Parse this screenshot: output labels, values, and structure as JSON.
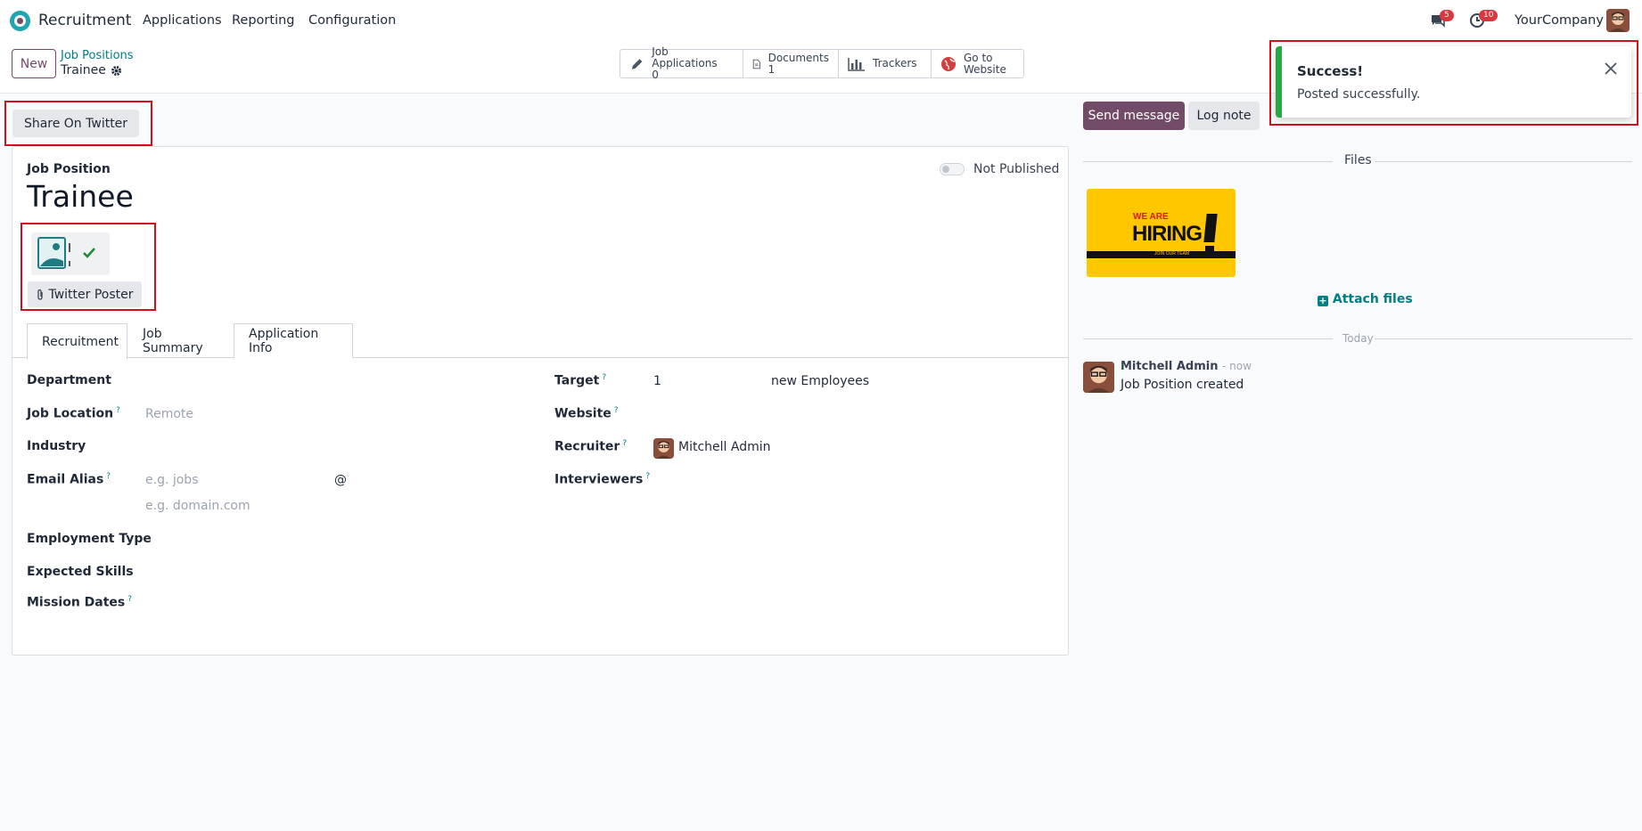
{
  "nav": {
    "app_name": "Recruitment",
    "menu": [
      "Applications",
      "Reporting",
      "Configuration"
    ],
    "messages_badge": "5",
    "activities_badge": "10",
    "company": "YourCompany"
  },
  "control": {
    "new_label": "New",
    "breadcrumb_parent": "Job Positions",
    "breadcrumb_current": "Trainee",
    "smart_buttons": [
      {
        "label": "Job Applications",
        "value": "0",
        "icon": "pencil-icon"
      },
      {
        "label": "Documents",
        "value": "1",
        "icon": "document-icon"
      },
      {
        "label": "Trackers",
        "value": "",
        "icon": "bar-chart-icon"
      },
      {
        "label": "Go to",
        "value": "Website",
        "icon": "globe-icon"
      }
    ]
  },
  "form": {
    "share_label": "Share On Twitter",
    "section_label": "Job Position",
    "title": "Trainee",
    "publish_label": "Not Published",
    "poster_label": "Twitter Poster",
    "tabs": [
      "Recruitment",
      "Job Summary",
      "Application Info"
    ],
    "left_fields": {
      "department": "Department",
      "job_location": "Job Location",
      "job_location_placeholder": "Remote",
      "industry": "Industry",
      "email_alias": "Email Alias",
      "alias_placeholder": "e.g. jobs",
      "alias_at": "@",
      "domain_placeholder": "e.g. domain.com",
      "employment_type": "Employment Type",
      "expected_skills": "Expected Skills",
      "mission_dates": "Mission Dates"
    },
    "right_fields": {
      "target": "Target",
      "target_value": "1",
      "target_unit": "new Employees",
      "website": "Website",
      "recruiter": "Recruiter",
      "recruiter_value": "Mitchell Admin",
      "interviewers": "Interviewers"
    },
    "help_mark": "?"
  },
  "chatter": {
    "send_label": "Send message",
    "log_label": "Log note",
    "files_title": "Files",
    "attach_label": "Attach files",
    "hiring_text_top": "WE ARE",
    "hiring_text_main": "HIRING",
    "hiring_text_sub": "JOIN OUR TEAM",
    "date_sep": "Today",
    "author": "Mitchell Admin",
    "time": "- now",
    "message": "Job Position created"
  },
  "toast": {
    "title": "Success!",
    "message": "Posted successfully."
  },
  "colors": {
    "brand": "#714b67",
    "accent": "#017e84",
    "highlight": "#d30f1c",
    "success": "#28a745"
  }
}
